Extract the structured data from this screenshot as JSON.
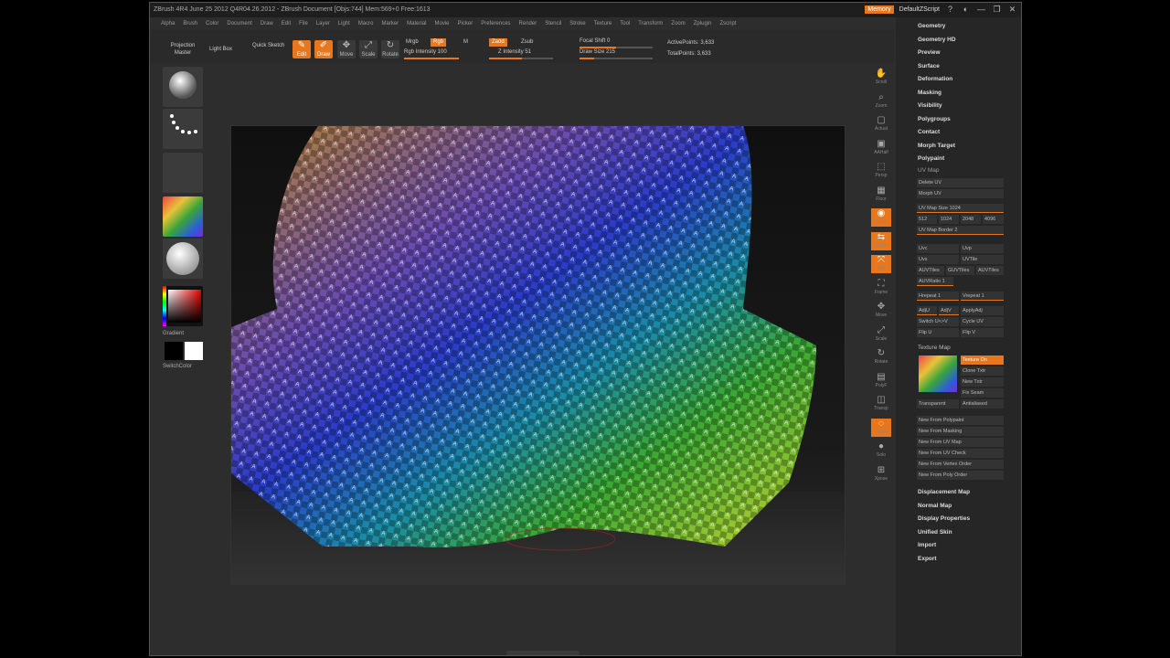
{
  "window": {
    "title": "ZBrush 4R4 June 25 2012 Q4R04.26.2012 - ZBrush Document    [Objs:744] Mem:569+0 Free:1613",
    "memory_badge": "Memory",
    "menu_label": "DefaultZScript",
    "controls": [
      "?",
      "◐",
      "—",
      "❐",
      "✕"
    ]
  },
  "menubar": [
    "Alpha",
    "Brush",
    "Color",
    "Document",
    "Draw",
    "Edit",
    "File",
    "Layer",
    "Light",
    "Macro",
    "Marker",
    "Material",
    "Movie",
    "Picker",
    "Preferences",
    "Render",
    "Stencil",
    "Stroke",
    "Texture",
    "Tool",
    "Transform",
    "Zoom",
    "Zplugin",
    "Zscript"
  ],
  "toolbar": {
    "projection": "Projection Master",
    "lightbox": "Light Box",
    "quicksketch": "Quick Sketch",
    "edit": "Edit",
    "draw": "Draw",
    "move": "Move",
    "scale": "Scale",
    "rotate": "Rotate",
    "mrgb": "Mrgb",
    "rgb": "Rgb",
    "m": "M",
    "rgb_intensity": "Rgb Intensity 100",
    "zadd": "Zadd",
    "zsub": "Zsub",
    "z_intensity": "Z Intensity 51",
    "focal_shift": "Focal Shift 0",
    "draw_size": "Draw Size 215",
    "active_points": "ActivePoints: 3,633",
    "total_points": "TotalPoints: 3,633",
    "rgb_intensity_value": 1.0,
    "z_intensity_value": 0.51,
    "focal_value": 0.5,
    "draw_size_value": 0.2
  },
  "left_shelf": {
    "gradient": "Gradient",
    "switchcolor": "SwitchColor"
  },
  "right_shelf": [
    "Scroll",
    "Zoom",
    "Actual",
    "AAHalf",
    "Persp",
    "Floor",
    "Local",
    "LSym",
    "Xyz",
    "Frame",
    "Move",
    "Scale",
    "Rotate",
    "PolyF",
    "Transp",
    "Ghost",
    "Solo",
    "Xpose"
  ],
  "tray": {
    "top_items": [
      "Geometry",
      "Geometry HD",
      "Preview",
      "Surface",
      "Deformation",
      "Masking",
      "Visibility",
      "Polygroups",
      "Contact",
      "Morph Target",
      "Polypaint"
    ],
    "uv_map": {
      "title": "UV Map",
      "delete_uv": "Delete UV",
      "morph_uv": "Morph UV",
      "uv_map_size": "UV Map Size 1024",
      "sizes": [
        "512",
        "1024",
        "2048",
        "4096"
      ],
      "uv_map_border": "UV Map Border 2",
      "uvc": "Uvc",
      "uvp": "Uvp",
      "uvs": "Uvs",
      "uvtile": "UVTile",
      "auvtiles": "AUVTiles",
      "guvtiles": "GUVTiles",
      "pauvtiles": "AUVTiles",
      "auvratio": "AUVRatio 1",
      "hrepeat": "Hrepeat 1",
      "vrepeat": "Vrepeat 1",
      "adju": "AdjU",
      "adjv": "AdjV",
      "applyadj": "ApplyAdj",
      "switch_uv": "Switch U<>V",
      "cycle_uv": "Cycle UV",
      "flip_u": "Flip U",
      "flip_v": "Flip V"
    },
    "texture_map": {
      "title": "Texture Map",
      "texture_on": "Texture On",
      "clone_txtr": "Clone Txtr",
      "new_txtr": "New Txtr",
      "fix_seam": "Fix Seam",
      "transparent": "Transparent",
      "antialiased": "Antialiased",
      "new_from": [
        "New From Polypaint",
        "New From Masking",
        "New From UV Map",
        "New From UV Check",
        "New From Vertex Order",
        "New From Poly Order"
      ]
    },
    "bottom_items": [
      "Displacement Map",
      "Normal Map",
      "Display Properties",
      "Unified Skin",
      "Import",
      "Export"
    ]
  },
  "colors": {
    "accent": "#e8761c",
    "panel": "#262626",
    "bg": "#2d2d2d"
  }
}
